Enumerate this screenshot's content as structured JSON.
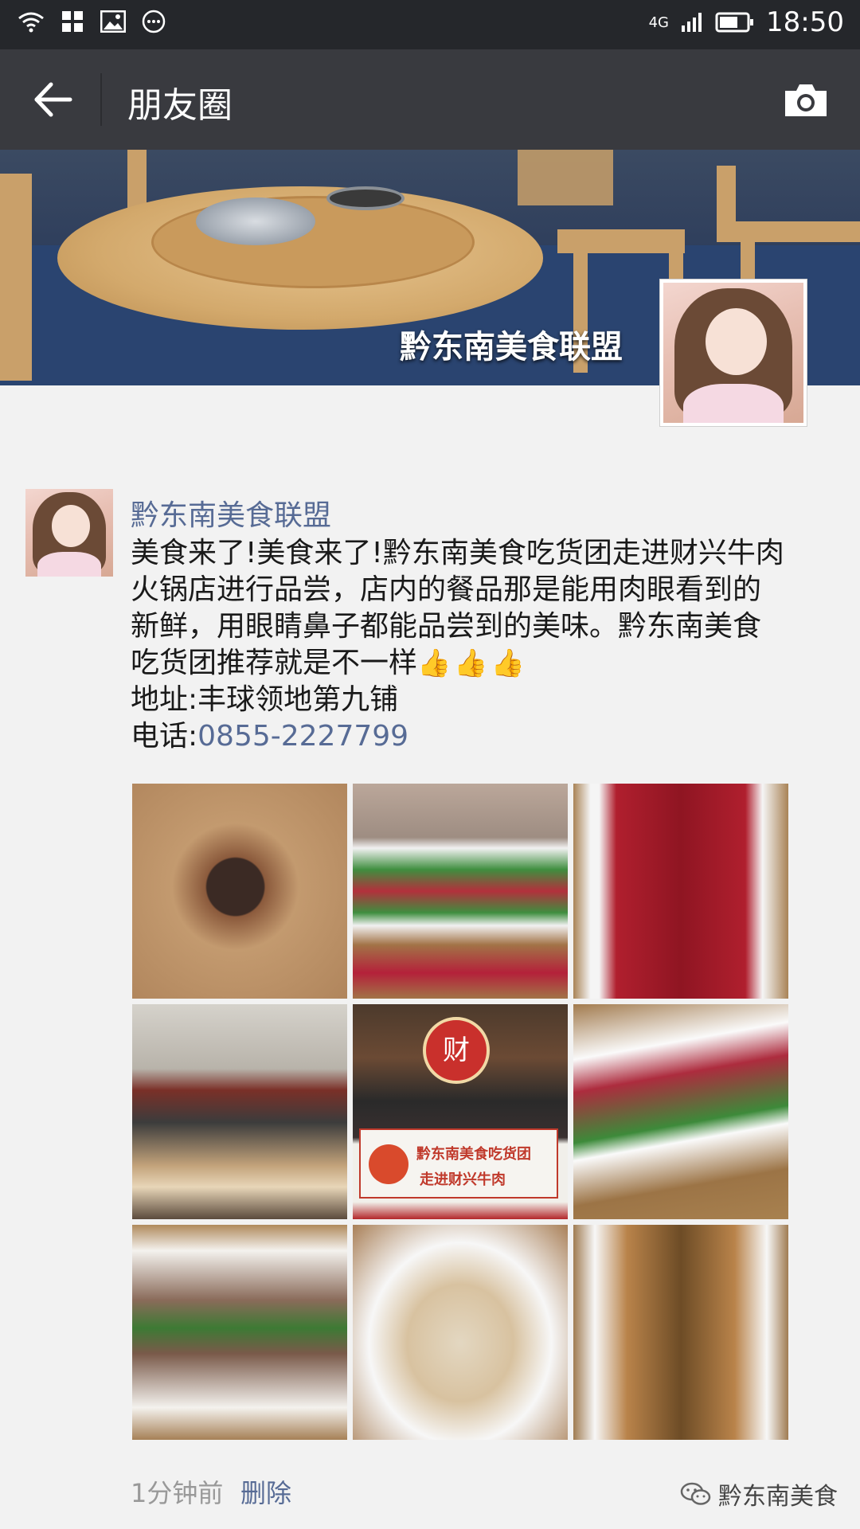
{
  "status_bar": {
    "network": "4G",
    "time": "18:50"
  },
  "header": {
    "title": "朋友圈"
  },
  "cover": {
    "caption": "黔东南美食联盟"
  },
  "post": {
    "author": "黔东南美食联盟",
    "text_lines": [
      "美食来了!美食来了!黔东南美食吃货团走进财兴牛肉",
      "火锅店进行品尝，店内的餐品那是能用肉眼看到的",
      "新鲜，用眼睛鼻子都能品尝到的美味。黔东南美食",
      "吃货团推荐就是不一样"
    ],
    "thumbs": [
      "👍",
      "👍",
      "👍"
    ],
    "address": "地址:丰球领地第九铺",
    "phone_label": "电话:",
    "phone": "0855-2227799",
    "photo_5_sign": "财",
    "photo_5_banner_line1": "黔东南美食吃货团",
    "photo_5_banner_line2": "走进财兴牛肉",
    "time_ago": "1分钟前",
    "delete_label": "删除"
  },
  "watermark": {
    "text": "黔东南美食"
  },
  "icons": {
    "back": "arrow-left-icon",
    "camera": "camera-icon",
    "wifi": "wifi-icon",
    "battery": "battery-icon",
    "signal": "signal-icon"
  },
  "colors": {
    "status_bar": "#25272b",
    "title_bar": "#393a3f",
    "link": "#576b95",
    "background": "#f2f2f2"
  }
}
